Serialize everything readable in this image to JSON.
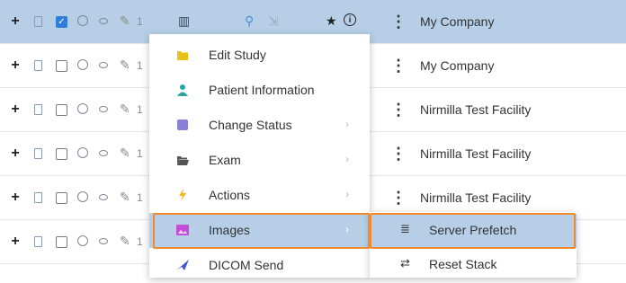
{
  "rows": [
    {
      "company": "My Company",
      "selected": true
    },
    {
      "company": "My Company",
      "selected": false
    },
    {
      "company": "Nirmilla Test Facility",
      "selected": false
    },
    {
      "company": "Nirmilla Test Facility",
      "selected": false
    },
    {
      "company": "Nirmilla Test Facility",
      "selected": false
    },
    {
      "company": "",
      "selected": false
    }
  ],
  "row_icons": {
    "expand": "+",
    "more": "1",
    "kebab": "⋮",
    "grid": "▥",
    "pin": "✎",
    "share": "⇲",
    "star": "★",
    "info": "i",
    "check": "✓"
  },
  "context_menu": {
    "items": [
      {
        "label": "Edit Study",
        "icon": "folder-icon",
        "color": "#e8c21a",
        "has_submenu": false
      },
      {
        "label": "Patient Information",
        "icon": "person-icon",
        "color": "#2aa3a3",
        "has_submenu": false
      },
      {
        "label": "Change Status",
        "icon": "status-square-icon",
        "color": "#8a7fd6",
        "has_submenu": true
      },
      {
        "label": "Exam",
        "icon": "folder-open-icon",
        "color": "#555555",
        "has_submenu": true
      },
      {
        "label": "Actions",
        "icon": "lightning-icon",
        "color": "#f2b61a",
        "has_submenu": true
      },
      {
        "label": "Images",
        "icon": "image-icon",
        "color": "#c34fd6",
        "has_submenu": true,
        "active": true
      },
      {
        "label": "DICOM Send",
        "icon": "send-icon",
        "color": "#3b57d6",
        "has_submenu": false
      }
    ],
    "arrow": "›"
  },
  "submenu": {
    "items": [
      {
        "label": "Server Prefetch",
        "icon_glyph": "≣",
        "active": true
      },
      {
        "label": "Reset Stack",
        "icon_glyph": "⇄",
        "active": false
      }
    ]
  },
  "colors": {
    "selected_row": "#b7cfe6",
    "highlight_border": "#f08a2c",
    "checkbox": "#2f7fd9"
  }
}
